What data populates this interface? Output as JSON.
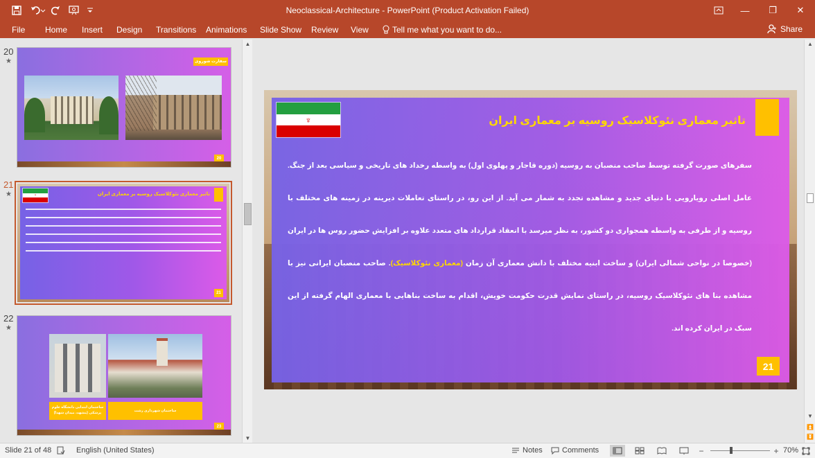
{
  "window": {
    "title": "Neoclassical-Architecture  -  PowerPoint (Product Activation Failed)",
    "minimize": "—",
    "restore": "❐",
    "close": "✕"
  },
  "quick_access": {
    "save_icon": "save-icon",
    "undo_icon": "undo-icon",
    "redo_icon": "redo-icon",
    "present_icon": "present-from-beginning-icon",
    "customize_icon": "customize-quick-access-icon"
  },
  "ribbon": {
    "tabs": [
      "File",
      "Home",
      "Insert",
      "Design",
      "Transitions",
      "Animations",
      "Slide Show",
      "Review",
      "View"
    ],
    "tell_me": "Tell me what you want to do...",
    "share": "Share",
    "colors": {
      "accent": "#b7472a"
    }
  },
  "thumbnails": [
    {
      "number": "20",
      "star": "★",
      "label": "سفارت شوروی",
      "slide_num": "20"
    },
    {
      "number": "21",
      "star": "★",
      "title": "تاثیر معماری نئوکلاسیک روسیه بر معماری ایران",
      "slide_num": "21"
    },
    {
      "number": "22",
      "star": "★",
      "caption_left": "ساختمان ابتدایی دانشگاه علوم پزشکی (مشهد، میدان شهدا)",
      "caption_right": "ساختمان شهرداری رشت",
      "slide_num": "23"
    }
  ],
  "main_slide": {
    "title": "تاثیر معماری نئوکلاسیک روسیه بر معماری ایران",
    "body": "سفرهای صورت گرفته توسط صاحب منصبان به روسیه (دوره قاجار و پهلوی اول) به واسطه رخداد های تاریخی و سیاسی بعد از جنگ. عامل اصلی رویارویی با دنیای جدید و مشاهده تجدد به شمار می آید. از این رو، در راستای تعاملات دیرینه در زمینه های مختلف با روسیه و از طرفی به واسطه همجواری دو کشور، به نظر میرسد با انعقاد قرارداد های متعدد علاوه بر افزایش حضور روس ها در ایران (خصوصا در نواحی شمالی ایران) و ساخت ابنیه مختلف با دانش معماری آن زمان",
    "highlight": "(معماری نئوکلاسیک)",
    "body_end": ". صاحب منصبان ایرانی نیز با مشاهده بنا های نئوکلاسیک روسیه، در راستای نمایش قدرت حکومت خویش، اقدام به ساخت بناهایی با معماری الهام گرفته از این سبک در ایران کرده اند.",
    "slide_num": "21",
    "colors": {
      "title": "#ffd800",
      "highlight": "#ffd800",
      "number_box": "#ffc000"
    }
  },
  "status_bar": {
    "slide_position": "Slide 21 of 48",
    "language": "English (United States)",
    "notes": "Notes",
    "comments": "Comments",
    "zoom_minus": "−",
    "zoom_plus": "+",
    "zoom_level": "70%"
  }
}
